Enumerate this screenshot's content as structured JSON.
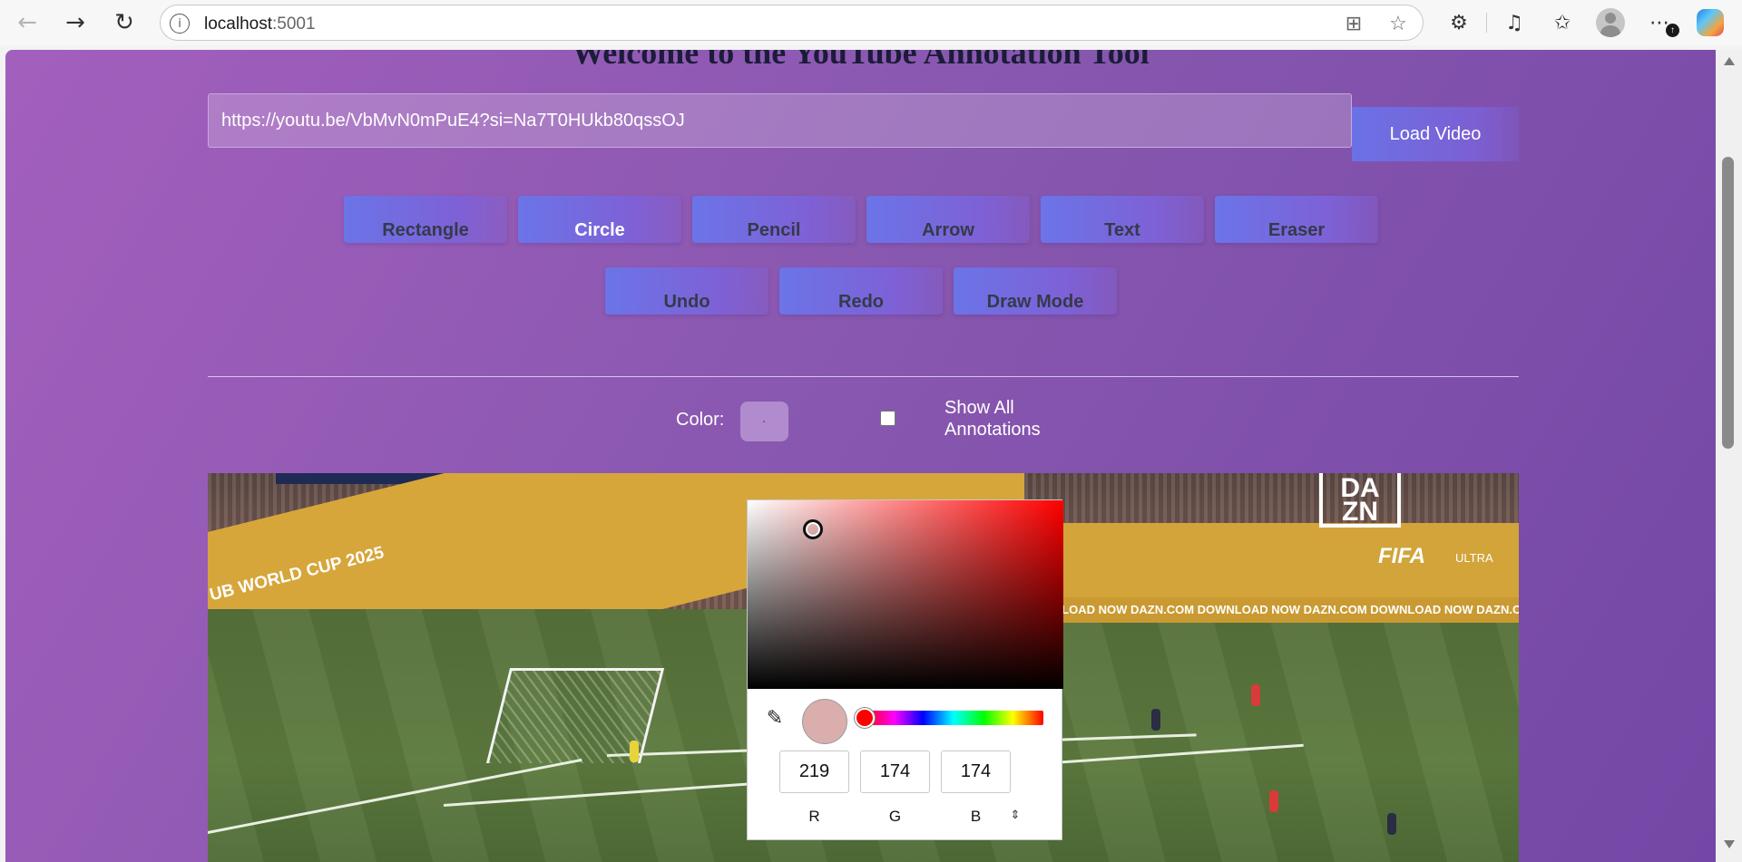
{
  "browser": {
    "back_icon": "back-arrow-icon",
    "forward_icon": "forward-arrow-icon",
    "refresh_icon": "refresh-icon",
    "address_host": "localhost",
    "address_port": ":5001",
    "notification_badge": "↑"
  },
  "page": {
    "title": "Welcome to the YouTube Annotation Tool",
    "video_url_value": "https://youtu.be/VbMvN0mPuE4?si=Na7T0HUkb80qssOJ",
    "load_button": "Load Video",
    "tools": [
      "Rectangle",
      "Circle",
      "Pencil",
      "Arrow",
      "Text",
      "Eraser"
    ],
    "active_tool": "Circle",
    "actions": [
      "Undo",
      "Redo",
      "Draw Mode"
    ],
    "color_label": "Color:",
    "show_all_label": "Show All Annotations",
    "show_all_checked": false,
    "colors": {
      "background_start": "#a35fbd",
      "background_end": "#7447a6",
      "button_gradient_start": "#6b74e8",
      "swatch": "#b08ccf"
    }
  },
  "video": {
    "sign_world_cup": "UB WORLD CUP 2025",
    "board_text": "DOWNLOAD NOW DAZN.COM   DOWNLOAD NOW DAZN.COM   DOWNLOAD NOW DAZN.COM",
    "sign_download": "DOWNLOAD NOW DAZN.COM",
    "dazn_logo": "DA ZN",
    "fifa": "FIFA",
    "ultra": "ULTRA"
  },
  "color_picker": {
    "r": "219",
    "g": "174",
    "b": "174",
    "r_label": "R",
    "g_label": "G",
    "b_label": "B",
    "selected_color": "#dbaeae",
    "hue_color": "#ff0000"
  }
}
